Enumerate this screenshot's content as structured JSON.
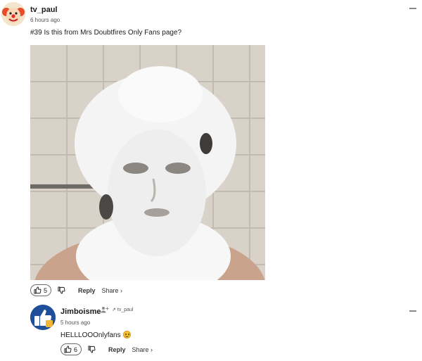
{
  "comments": [
    {
      "username": "tv_paul",
      "time": "6 hours ago",
      "text": "#39 Is this from Mrs Doubtfires Only Fans page?",
      "likes": "5",
      "reply_label": "Reply",
      "share_label": "Share ›",
      "avatar_icon": "clown-avatar-icon",
      "image_icon": "foam-covered-head-photo"
    },
    {
      "username": "Jimboisme",
      "time": "5 hours ago",
      "text": "HELLLOOOnlyfans",
      "likes": "6",
      "reply_label": "Reply",
      "share_label": "Share ›",
      "reply_to": "tv_paul",
      "avatar_icon": "thumbs-up-avatar-icon",
      "emoji": "grinning-face-emoji"
    }
  ],
  "colors": {
    "text": "#1a1a1b",
    "muted": "#555555",
    "avatar_blue": "#1f4e9a",
    "emoji_yellow": "#f6c232"
  }
}
